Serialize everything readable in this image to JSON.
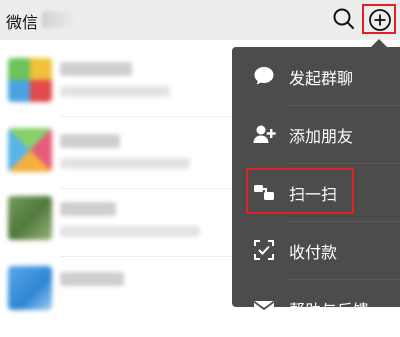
{
  "header": {
    "title": "微信",
    "search_icon": "search-icon",
    "add_icon": "plus-circle-icon",
    "highlight_color": "#e0212c"
  },
  "menu": {
    "background": "#4c4c4c",
    "items": [
      {
        "label": "发起群聊",
        "icon": "chat-bubble-icon"
      },
      {
        "label": "添加朋友",
        "icon": "add-friend-icon"
      },
      {
        "label": "扫一扫",
        "icon": "scan-icon",
        "highlighted": true
      },
      {
        "label": "收付款",
        "icon": "payment-scan-icon"
      },
      {
        "label": "帮助与反馈",
        "icon": "mail-icon"
      }
    ]
  }
}
